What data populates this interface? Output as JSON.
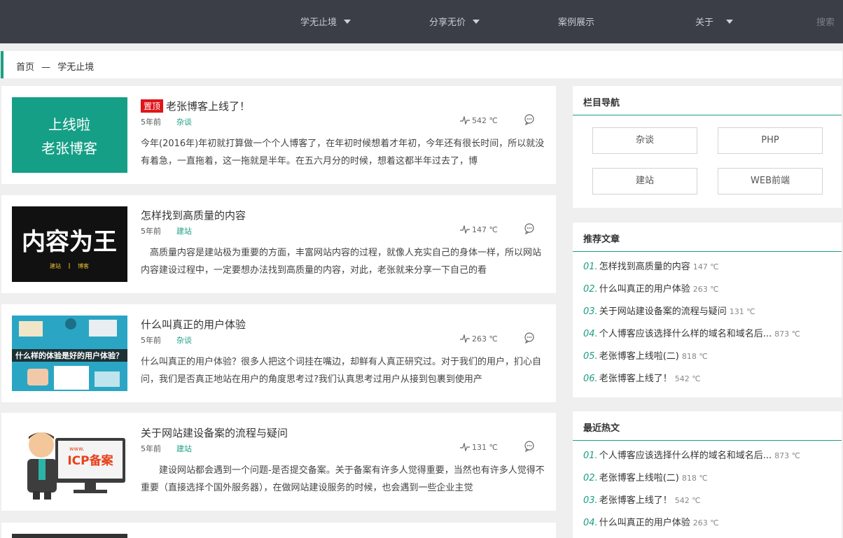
{
  "nav": {
    "items": [
      {
        "label": "学无止境",
        "has_dropdown": true
      },
      {
        "label": "分享无价",
        "has_dropdown": true
      },
      {
        "label": "案例展示",
        "has_dropdown": false
      },
      {
        "label": "关于",
        "has_dropdown": true
      }
    ],
    "search_label": "搜索"
  },
  "breadcrumb": {
    "home": "首页",
    "separator": "—",
    "current": "学无止境"
  },
  "articles": [
    {
      "pinned_label": "置顶",
      "title": "老张博客上线了！",
      "time": "5年前",
      "category": "杂谈",
      "heat": "542 ℃",
      "excerpt": "今年(2016年)年初就打算做一个个人博客了，在年初时候想着才年初，今年还有很长时间，所以就没有着急，一直拖着，这一拖就是半年。在五六月分的时候，想着这都半年过去了，博",
      "thumb": {
        "line1": "上线啦",
        "line2": "老张博客",
        "bg": "#159f86"
      }
    },
    {
      "title": "怎样找到高质量的内容",
      "time": "5年前",
      "category": "建站",
      "heat": "147 ℃",
      "excerpt": "　高质量内容是建站极为重要的方面，丰富网站内容的过程，就像人充实自己的身体一样，所以网站内容建设过程中，一定要想办法找到高质量的内容，对此，老张就来分享一下自己的看",
      "thumb": {
        "line1": "内容为王",
        "tag1": "建站",
        "tag2": "博客",
        "bg": "#111111"
      }
    },
    {
      "title": "什么叫真正的用户体验",
      "time": "5年前",
      "category": "杂谈",
      "heat": "263 ℃",
      "excerpt": "什么叫真正的用户体验？很多人把这个词挂在嘴边，却鲜有人真正研究过。对于我们的用户，扪心自问，我们是否真正地站在用户的角度思考过?我们认真思考过用户从接到包裹到使用产",
      "thumb": {
        "banner": "什么样的体验是好的用户体验？",
        "bg": "#2aa6c4"
      }
    },
    {
      "title": "关于网站建设备案的流程与疑问",
      "time": "5年前",
      "category": "建站",
      "heat": "131 ℃",
      "excerpt": "　　建设网站都会遇到一个问题-是否提交备案。关于备案有许多人觉得重要，当然也有许多人觉得不重要（直接选择个国外服务器），在做网站建设服务的时候，也会遇到一些企业主觉",
      "thumb": {
        "www": "www.",
        "icp": "ICP备案",
        "bg": "#ffffff"
      }
    }
  ],
  "sidebar": {
    "column_nav": {
      "title": "栏目导航",
      "tags": [
        "杂谈",
        "PHP",
        "建站",
        "WEB前端"
      ]
    },
    "recommended": {
      "title": "推荐文章",
      "items": [
        {
          "num": "01.",
          "title": "怎样找到高质量的内容",
          "heat": "147 ℃"
        },
        {
          "num": "02.",
          "title": "什么叫真正的用户体验",
          "heat": "263 ℃"
        },
        {
          "num": "03.",
          "title": "关于网站建设备案的流程与疑问",
          "heat": "131 ℃"
        },
        {
          "num": "04.",
          "title": "个人博客应该选择什么样的域名和域名后...",
          "heat": "873 ℃"
        },
        {
          "num": "05.",
          "title": "老张博客上线啦(二)",
          "heat": "818 ℃"
        },
        {
          "num": "06.",
          "title": "老张博客上线了！",
          "heat": "542 ℃"
        }
      ]
    },
    "hot": {
      "title": "最近热文",
      "items": [
        {
          "num": "01.",
          "title": "个人博客应该选择什么样的域名和域名后...",
          "heat": "873 ℃"
        },
        {
          "num": "02.",
          "title": "老张博客上线啦(二)",
          "heat": "818 ℃"
        },
        {
          "num": "03.",
          "title": "老张博客上线了！",
          "heat": "542 ℃"
        },
        {
          "num": "04.",
          "title": "什么叫真正的用户体验",
          "heat": "263 ℃"
        }
      ]
    }
  },
  "colors": {
    "accent": "#1e9e84",
    "nav_bg": "#3b3e47",
    "pin_red": "#e0141a"
  }
}
